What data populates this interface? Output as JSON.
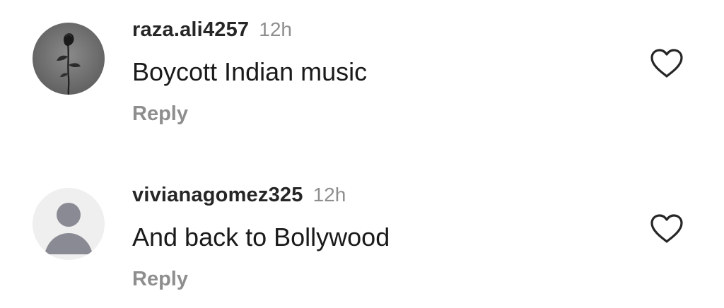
{
  "comments": [
    {
      "username": "raza.ali4257",
      "time": "12h",
      "text": "Boycott Indian music",
      "reply_label": "Reply",
      "avatar": "rose-photo-avatar",
      "like_icon": "heart-outline-icon"
    },
    {
      "username": "vivianagomez325",
      "time": "12h",
      "text": "And back to Bollywood",
      "reply_label": "Reply",
      "avatar": "default-user-avatar",
      "like_icon": "heart-outline-icon"
    }
  ],
  "colors": {
    "username": "#262626",
    "text": "#1a1a1a",
    "muted": "#8e8e8e",
    "heart_stroke": "#262626",
    "default_avatar_bg": "#efefef",
    "default_avatar_figure": "#8a8a94"
  }
}
